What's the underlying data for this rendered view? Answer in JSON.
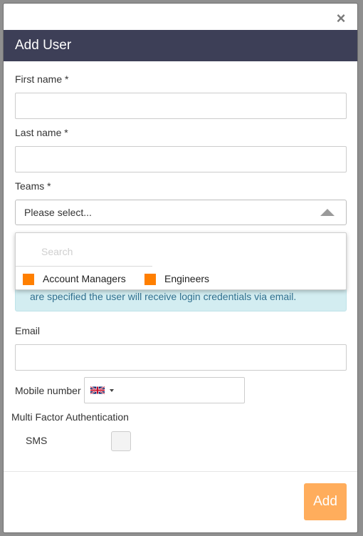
{
  "modal": {
    "title": "Add User",
    "close_label": "×"
  },
  "form": {
    "first_name_label": "First name *",
    "last_name_label": "Last name *",
    "teams_label": "Teams *",
    "teams_placeholder": "Please select...",
    "teams_search_placeholder": "Search",
    "teams_options": [
      {
        "label": "Account Managers",
        "color": "#ff7f00"
      },
      {
        "label": "Engineers",
        "color": "#ff7f00"
      }
    ],
    "info_text": "are specified the user will receive login credentials via email.",
    "email_label": "Email",
    "mobile_label": "Mobile number",
    "mobile_flag_icon": "uk-flag-icon",
    "mfa_label": "Multi Factor Authentication",
    "sms_label": "SMS"
  },
  "footer": {
    "add_label": "Add"
  },
  "colors": {
    "header_bg": "#3d3f57",
    "accent": "#ffad5c",
    "team_swatch": "#ff7f00",
    "info_bg": "#d3edf1"
  }
}
